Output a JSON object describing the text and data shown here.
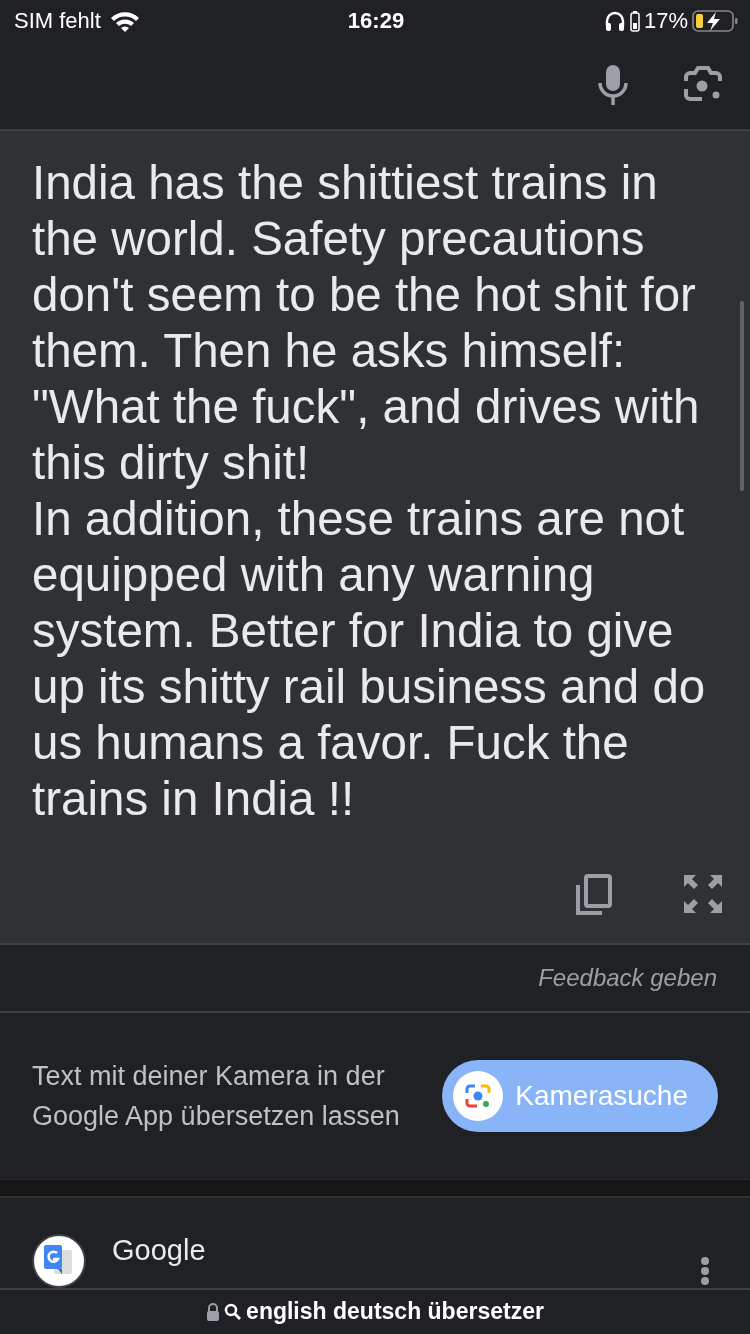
{
  "status_bar": {
    "carrier": "SIM fehlt",
    "time": "16:29",
    "battery_percent": "17%"
  },
  "translation": {
    "text": "India has the shittiest trains in the world. Safety precautions don't seem to be the hot shit for them. Then he asks himself: \"What the fuck\", and drives with this dirty shit!\nIn addition, these trains are not equipped with any warning system. Better for India to give up its shitty rail business and do us humans a favor. Fuck the trains in India !!"
  },
  "feedback": {
    "label": "Feedback geben"
  },
  "camera_promo": {
    "text": "Text mit deiner Kamera in der Google App übersetzen lassen",
    "button": "Kamerasuche"
  },
  "search_result": {
    "site": "Google"
  },
  "address_bar": {
    "query": "english deutsch übersetzer"
  }
}
